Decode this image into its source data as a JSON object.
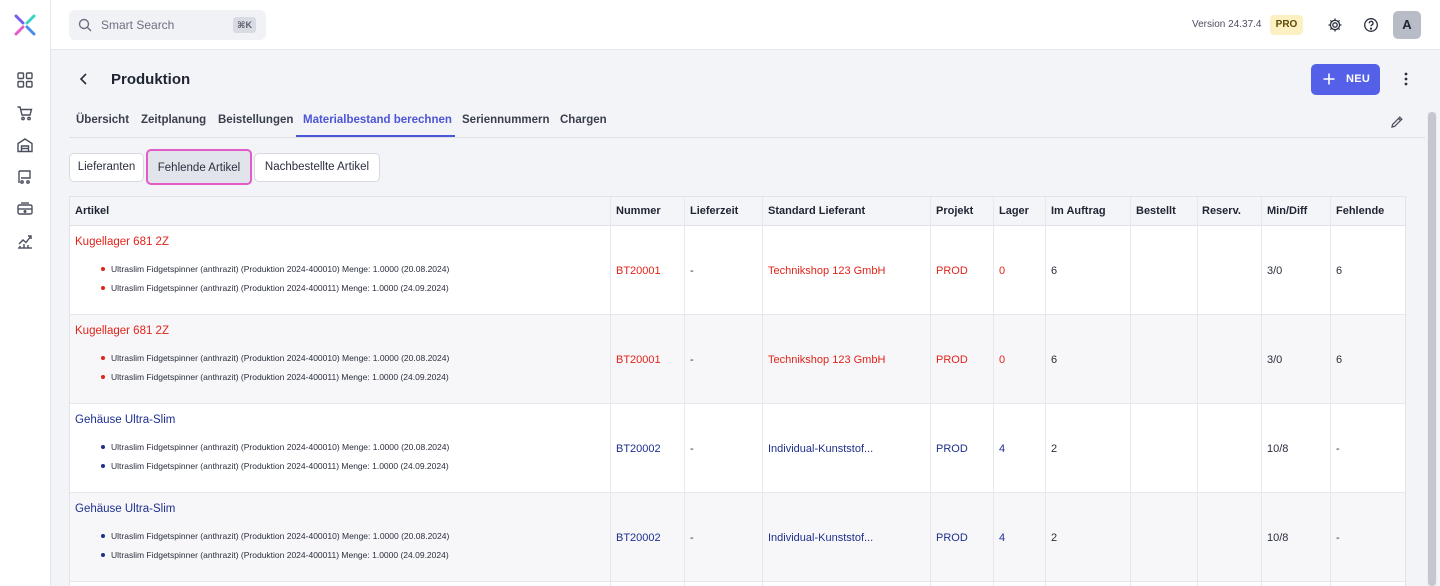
{
  "search": {
    "placeholder": "Smart Search",
    "shortcut": "⌘K"
  },
  "header": {
    "version": "Version 24.37.4",
    "plan_badge": "PRO",
    "avatar_initial": "A"
  },
  "page": {
    "title": "Produktion",
    "new_button": "NEU"
  },
  "tabs": [
    {
      "label": "Übersicht"
    },
    {
      "label": "Zeitplanung"
    },
    {
      "label": "Beistellungen"
    },
    {
      "label": "Materialbestand berechnen",
      "active": true
    },
    {
      "label": "Seriennummern"
    },
    {
      "label": "Chargen"
    }
  ],
  "subtabs": [
    {
      "label": "Lieferanten"
    },
    {
      "label": "Fehlende Artikel",
      "active": true
    },
    {
      "label": "Nachbestellte Artikel"
    }
  ],
  "table": {
    "columns": [
      "Artikel",
      "Nummer",
      "Lieferzeit",
      "Standard Lieferant",
      "Projekt",
      "Lager",
      "Im Auftrag",
      "Bestellt",
      "Reserv.",
      "Min/Diff",
      "Fehlende"
    ],
    "rows": [
      {
        "status": "missing",
        "artikel": "Kugellager 681 2Z",
        "details": [
          "Ultraslim Fidgetspinner (anthrazit) (Produktion 2024-400010) Menge: 1.0000 (20.08.2024)",
          "Ultraslim Fidgetspinner (anthrazit) (Produktion 2024-400011) Menge: 1.0000 (24.09.2024)"
        ],
        "nummer": "BT20001",
        "lieferzeit": "-",
        "lieferant": "Technikshop 123 GmbH",
        "projekt": "PROD",
        "lager": "0",
        "im_auftrag": "6",
        "bestellt": "",
        "reserv": "",
        "min_diff": "3/0",
        "fehlende": "6"
      },
      {
        "status": "missing",
        "artikel": "Kugellager 681 2Z",
        "details": [
          "Ultraslim Fidgetspinner (anthrazit) (Produktion 2024-400010) Menge: 1.0000 (20.08.2024)",
          "Ultraslim Fidgetspinner (anthrazit) (Produktion 2024-400011) Menge: 1.0000 (24.09.2024)"
        ],
        "nummer": "BT20001",
        "lieferzeit": "-",
        "lieferant": "Technikshop 123 GmbH",
        "projekt": "PROD",
        "lager": "0",
        "im_auftrag": "6",
        "bestellt": "",
        "reserv": "",
        "min_diff": "3/0",
        "fehlende": "6"
      },
      {
        "status": "ok",
        "artikel": "Gehäuse Ultra-Slim",
        "details": [
          "Ultraslim Fidgetspinner (anthrazit) (Produktion 2024-400010) Menge: 1.0000 (20.08.2024)",
          "Ultraslim Fidgetspinner (anthrazit) (Produktion 2024-400011) Menge: 1.0000 (24.09.2024)"
        ],
        "nummer": "BT20002",
        "lieferzeit": "-",
        "lieferant": "Individual-Kunststof...",
        "projekt": "PROD",
        "lager": "4",
        "im_auftrag": "2",
        "bestellt": "",
        "reserv": "",
        "min_diff": "10/8",
        "fehlende": "-"
      },
      {
        "status": "ok",
        "artikel": "Gehäuse Ultra-Slim",
        "details": [
          "Ultraslim Fidgetspinner (anthrazit) (Produktion 2024-400010) Menge: 1.0000 (20.08.2024)",
          "Ultraslim Fidgetspinner (anthrazit) (Produktion 2024-400011) Menge: 1.0000 (24.09.2024)"
        ],
        "nummer": "BT20002",
        "lieferzeit": "-",
        "lieferant": "Individual-Kunststof...",
        "projekt": "PROD",
        "lager": "4",
        "im_auftrag": "2",
        "bestellt": "",
        "reserv": "",
        "min_diff": "10/8",
        "fehlende": "-"
      }
    ]
  },
  "colors": {
    "accent": "#4b55d6",
    "primary_button": "#5560e8",
    "missing": "#e0241b",
    "ok": "#1d2f8f",
    "highlight": "#e25bc7"
  },
  "icons": {
    "rail": [
      "dashboard-icon",
      "cart-icon",
      "warehouse-icon",
      "production-icon",
      "register-icon",
      "analytics-icon"
    ],
    "top": [
      "gear-icon",
      "help-icon"
    ]
  }
}
